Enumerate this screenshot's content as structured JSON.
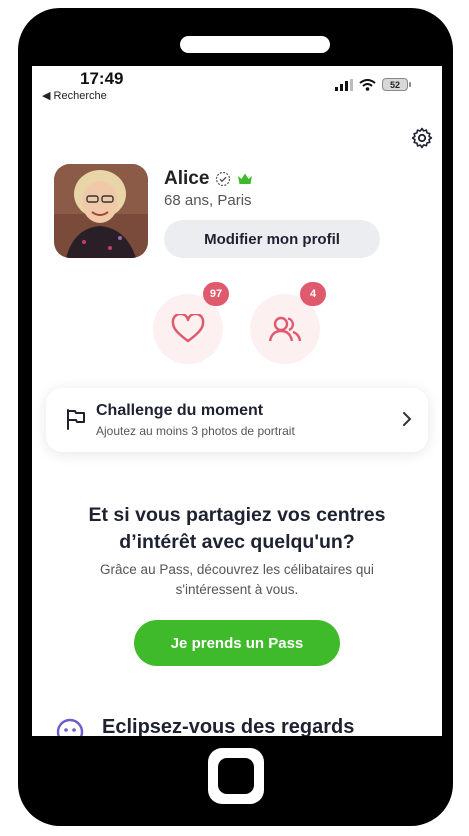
{
  "status_bar": {
    "time": "17:49",
    "back_label": "◀ Recherche",
    "battery": "52"
  },
  "profile": {
    "name": "Alice",
    "details": "68 ans, Paris",
    "edit_button": "Modifier mon profil"
  },
  "stats": {
    "likes_count": "97",
    "visits_count": "4"
  },
  "challenge": {
    "title": "Challenge du moment",
    "subtitle": "Ajoutez au moins 3 photos de portrait"
  },
  "promo": {
    "title_line1": "Et si vous partagiez vos centres",
    "title_line2": "d’intérêt avec quelqu'un?",
    "subtitle_line1": "Grâce au Pass, découvrez les célibataires qui",
    "subtitle_line2": "s'intéressent à vous.",
    "button": "Je prends un Pass"
  },
  "next_section": {
    "title": "Eclipsez-vous des regards"
  },
  "colors": {
    "accent_green": "#3fba2a",
    "badge_red": "#e05a6e",
    "premium_green": "#3fba2a"
  }
}
